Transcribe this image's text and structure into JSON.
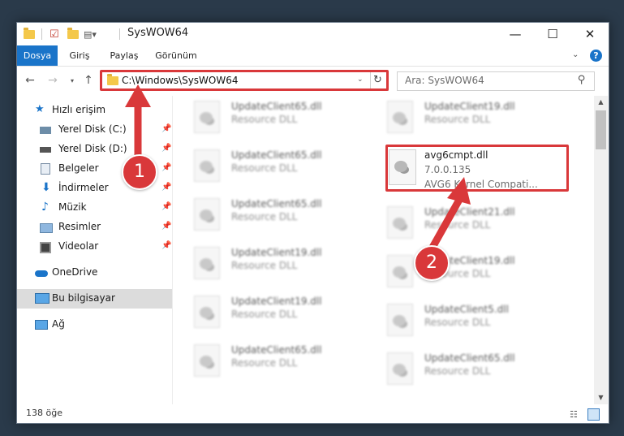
{
  "window": {
    "title": "SysWOW64"
  },
  "ribbon": {
    "tabs": [
      "Dosya",
      "Giriş",
      "Paylaş",
      "Görünüm"
    ]
  },
  "address": {
    "path": "C:\\Windows\\SysWOW64"
  },
  "search": {
    "placeholder": "Ara: SysWOW64"
  },
  "sidebar": {
    "quick_access": "Hızlı erişim",
    "items": [
      {
        "label": "Yerel Disk (C:)"
      },
      {
        "label": "Yerel Disk (D:)"
      },
      {
        "label": "Belgeler"
      },
      {
        "label": "İndirmeler"
      },
      {
        "label": "Müzik"
      },
      {
        "label": "Resimler"
      },
      {
        "label": "Videolar"
      }
    ],
    "onedrive": "OneDrive",
    "this_pc": "Bu bilgisayar",
    "network": "Ağ"
  },
  "files": {
    "left": [
      {
        "name": "UpdateClient65.dll",
        "sub": "Resource DLL"
      },
      {
        "name": "UpdateClient65.dll",
        "sub": "Resource DLL"
      },
      {
        "name": "UpdateClient65.dll",
        "sub": "Resource DLL"
      },
      {
        "name": "UpdateClient19.dll",
        "sub": "Resource DLL"
      },
      {
        "name": "UpdateClient19.dll",
        "sub": "Resource DLL"
      },
      {
        "name": "UpdateClient65.dll",
        "sub": "Resource DLL"
      }
    ],
    "right": [
      {
        "name": "UpdateClient19.dll",
        "sub": "Resource DLL"
      },
      {
        "name": "UpdateClient21.dll",
        "sub": "Resource DLL"
      },
      {
        "name": "UpdateClient19.dll",
        "sub": "Resource DLL"
      },
      {
        "name": "UpdateClient5.dll",
        "sub": "Resource DLL"
      },
      {
        "name": "UpdateClient65.dll",
        "sub": "Resource DLL"
      }
    ],
    "highlight": {
      "name": "avg6cmpt.dll",
      "version": "7.0.0.135",
      "description": "AVG6 Kernel Compati..."
    }
  },
  "status": {
    "count": "138 öğe"
  },
  "callouts": [
    "1",
    "2"
  ],
  "colors": {
    "accent": "#1a74c9",
    "highlight": "#d9383a"
  }
}
